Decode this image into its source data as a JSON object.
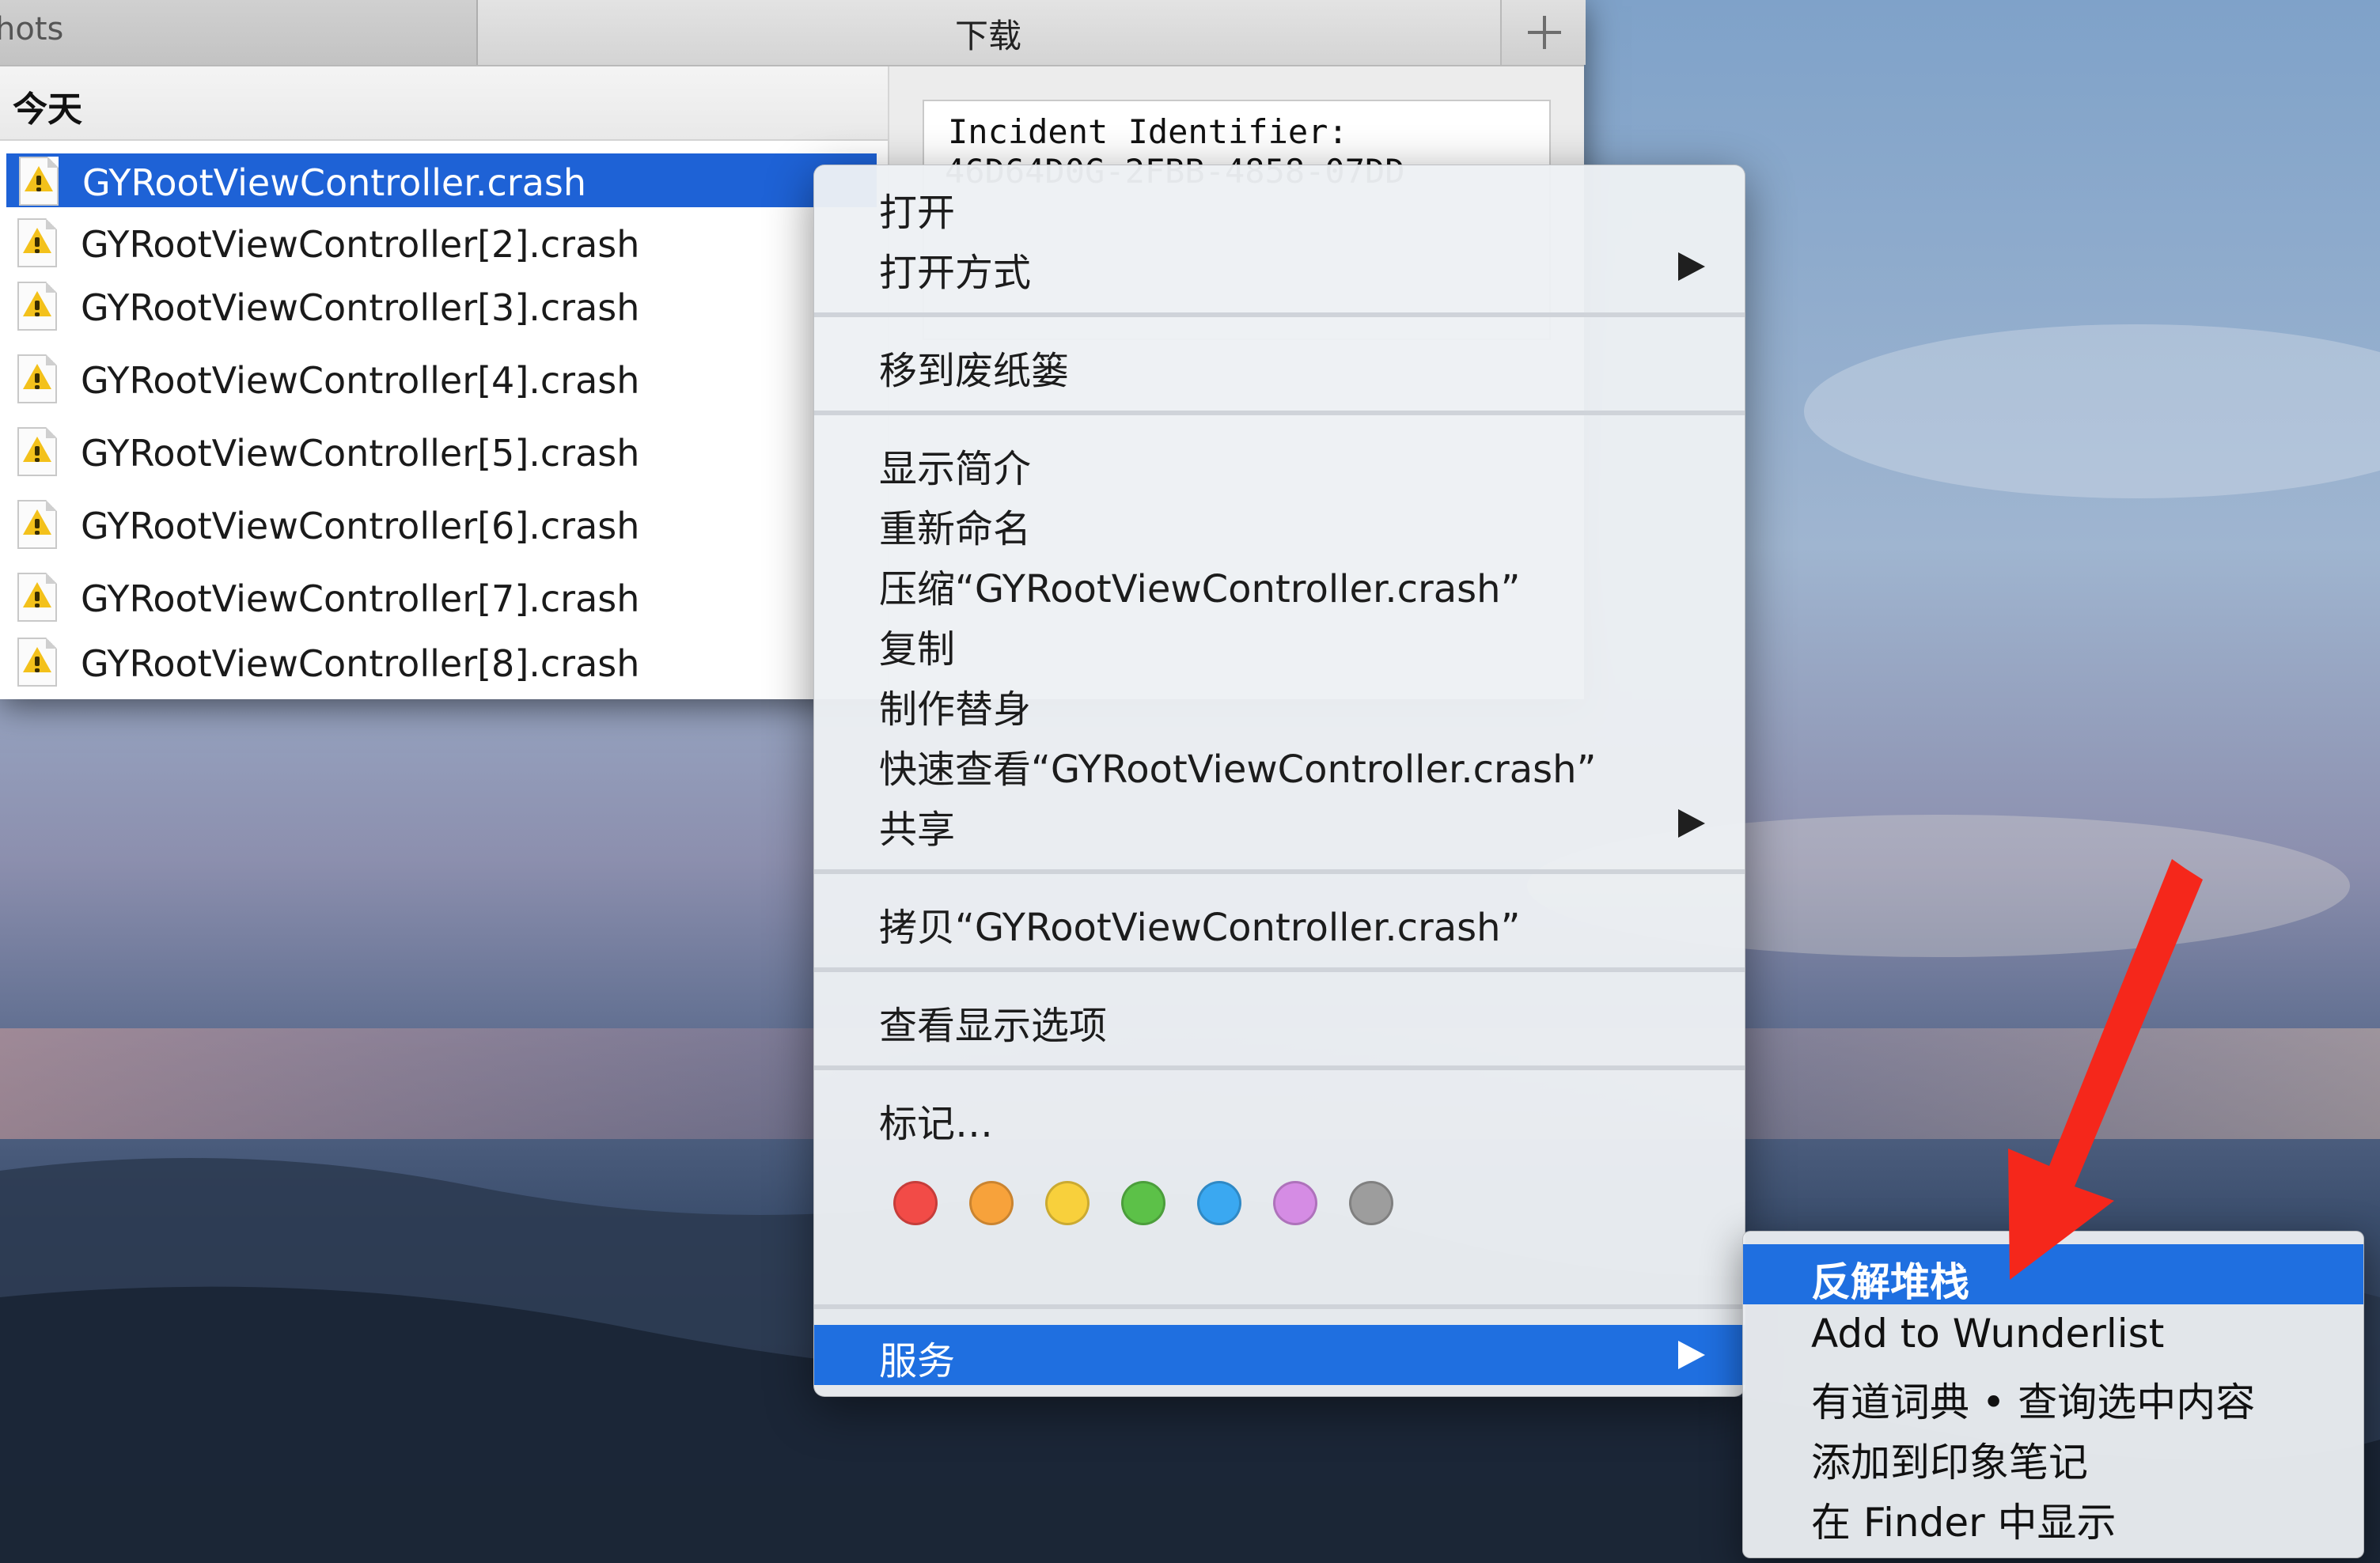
{
  "finder": {
    "tabs": [
      {
        "label": "hots"
      },
      {
        "label": "下载"
      }
    ],
    "group_header": "今天",
    "files": [
      {
        "name": "GYRootViewController.crash"
      },
      {
        "name": "GYRootViewController[2].crash"
      },
      {
        "name": "GYRootViewController[3].crash"
      },
      {
        "name": "GYRootViewController[4].crash"
      },
      {
        "name": "GYRootViewController[5].crash"
      },
      {
        "name": "GYRootViewController[6].crash"
      },
      {
        "name": "GYRootViewController[7].crash"
      },
      {
        "name": "GYRootViewController[8].crash"
      }
    ],
    "preview": {
      "line1": "Incident Identifier:",
      "line2": "46D64D0G-2FBB-4858-07DD"
    }
  },
  "context_menu": {
    "items": {
      "open": "打开",
      "open_with": "打开方式",
      "move_to_trash": "移到废纸篓",
      "get_info": "显示简介",
      "rename": "重新命名",
      "compress": "压缩“GYRootViewController.crash”",
      "duplicate": "复制",
      "make_alias": "制作替身",
      "quick_look": "快速查看“GYRootViewController.crash”",
      "share": "共享",
      "copy": "拷贝“GYRootViewController.crash”",
      "show_view_options": "查看显示选项",
      "tags": "标记…",
      "services": "服务"
    },
    "tag_colors": [
      "#f24b47",
      "#f7a23b",
      "#f8d03c",
      "#5cc148",
      "#3aa8f1",
      "#d58ce4",
      "#9d9d9d"
    ]
  },
  "services_submenu": {
    "items": {
      "symbolicate": "反解堆栈",
      "wunderlist": "Add to Wunderlist",
      "youdao": "有道词典 • 查询选中内容",
      "evernote": "添加到印象笔记",
      "show_in_finder": "在 Finder 中显示"
    }
  },
  "colors": {
    "selection": "#1f6fe0",
    "annotation_arrow": "#f5271b"
  }
}
